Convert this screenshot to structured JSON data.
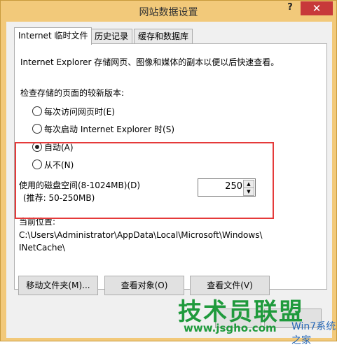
{
  "window": {
    "title": "网站数据设置",
    "help_label": "?",
    "close_label": "✕"
  },
  "tabs": [
    {
      "label": "Internet 临时文件",
      "active": true
    },
    {
      "label": "历史记录",
      "active": false
    },
    {
      "label": "缓存和数据库",
      "active": false
    }
  ],
  "panel": {
    "description": "Internet Explorer 存储网页、图像和媒体的副本以便以后快速查看。",
    "check_label": "检查存储的页面的较新版本:",
    "options": [
      {
        "label": "每次访问网页时(E)",
        "checked": false
      },
      {
        "label": "每次启动 Internet Explorer 时(S)",
        "checked": false
      },
      {
        "label": "自动(A)",
        "checked": true
      },
      {
        "label": "从不(N)",
        "checked": false
      }
    ],
    "disk_label": "使用的磁盘空间(8-1024MB)(D)",
    "disk_hint": "(推荐: 50-250MB)",
    "disk_value": "250",
    "location_label": "当前位置:",
    "location_path_line1": "C:\\Users\\Administrator\\AppData\\Local\\Microsoft\\Windows\\",
    "location_path_line2": "INetCache\\"
  },
  "buttons": {
    "move_folder": "移动文件夹(M)...",
    "view_objects": "查看对象(O)",
    "view_files": "查看文件(V)"
  },
  "watermark": {
    "main": "技术员联盟",
    "site": "www.jsgho.com",
    "tail": "Win7系统之家"
  },
  "colors": {
    "title_bar": "#f2c97a",
    "close_button": "#c7393a",
    "highlight_box": "#e53a3a",
    "watermark_green": "#1f9a3c"
  }
}
